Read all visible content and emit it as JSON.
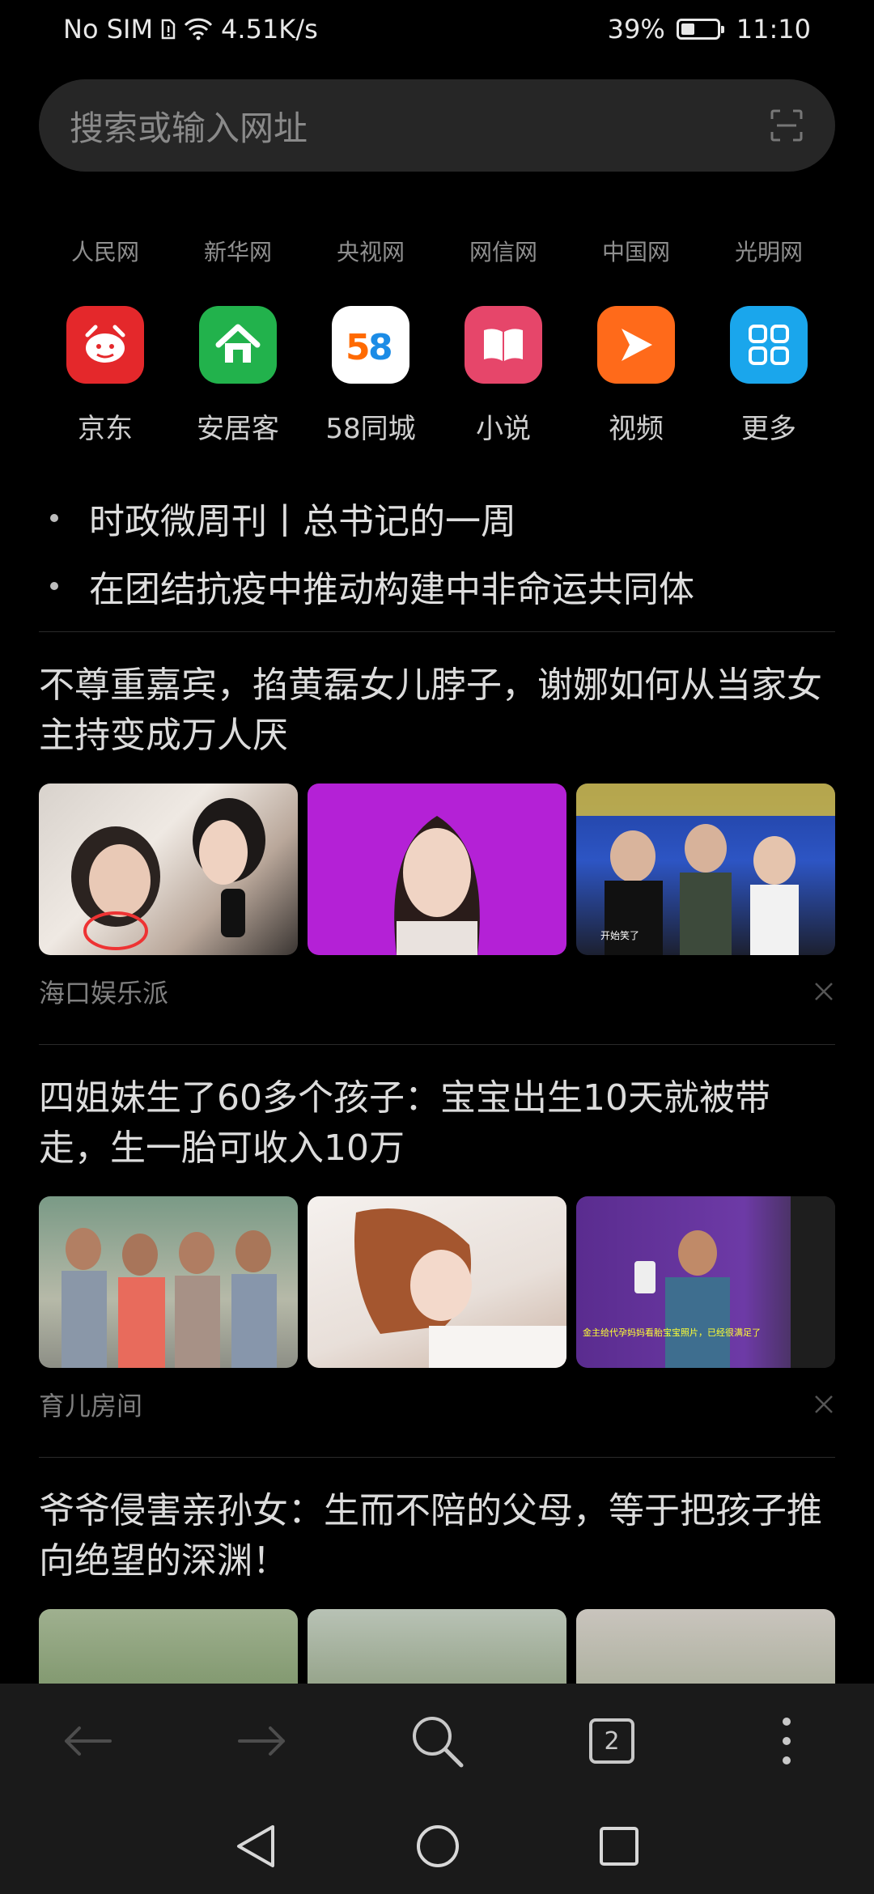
{
  "status_bar": {
    "carrier": "No SIM",
    "speed": "4.51K/s",
    "battery": "39%",
    "battery_level": 0.39,
    "time": "11:10"
  },
  "search": {
    "placeholder": "搜索或输入网址"
  },
  "quick_links": [
    "人民网",
    "新华网",
    "央视网",
    "网信网",
    "中国网",
    "光明网"
  ],
  "apps": [
    {
      "label": "京东",
      "icon": "jd-icon",
      "color": "#e4282b"
    },
    {
      "label": "安居客",
      "icon": "anjuke-home-icon",
      "color": "#22b24c"
    },
    {
      "label": "58同城",
      "icon": "58-icon",
      "color": "#ffffff"
    },
    {
      "label": "小说",
      "icon": "book-icon",
      "color": "#e6466a"
    },
    {
      "label": "视频",
      "icon": "video-play-icon",
      "color": "#ff6a1a"
    },
    {
      "label": "更多",
      "icon": "grid-icon",
      "color": "#1aa6ec"
    }
  ],
  "headlines": [
    "时政微周刊丨总书记的一周",
    "在团结抗疫中推动构建中非命运共同体"
  ],
  "articles": [
    {
      "title": "不尊重嘉宾，掐黄磊女儿脖子，谢娜如何从当家女主持变成万人厌",
      "source": "海口娱乐派"
    },
    {
      "title": "四姐妹生了60多个孩子：宝宝出生10天就被带走，生一胎可收入10万",
      "source": "育儿房间"
    },
    {
      "title": "爷爷侵害亲孙女：生而不陪的父母，等于把孩子推向绝望的深渊！",
      "source": ""
    }
  ],
  "toolbar": {
    "tab_count": "2"
  }
}
